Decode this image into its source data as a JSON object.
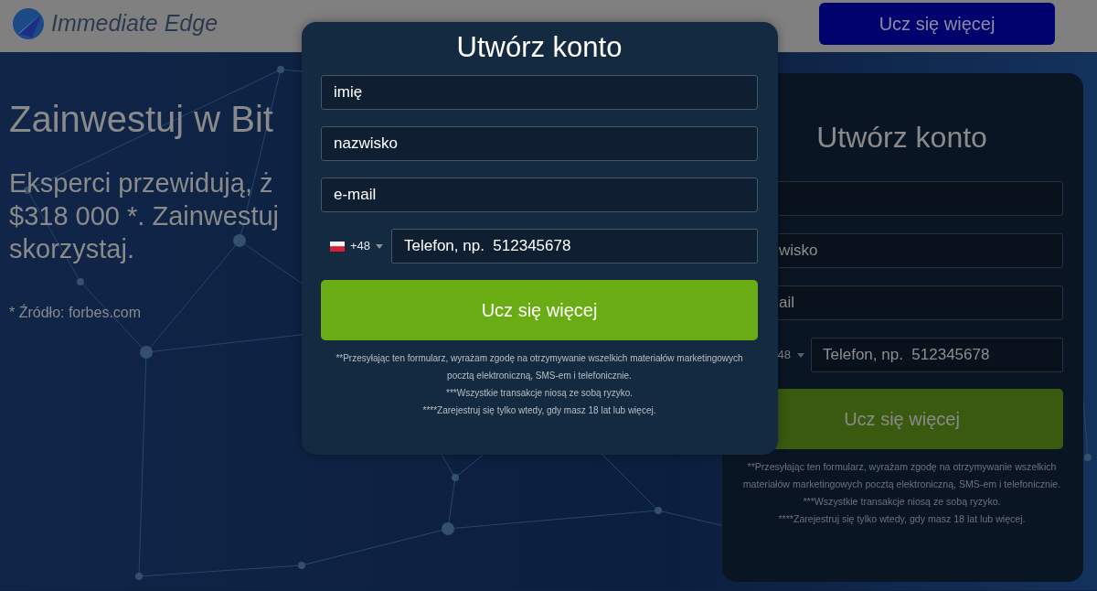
{
  "header": {
    "logo_text": "Immediate Edge",
    "cta_button": "Ucz się więcej"
  },
  "hero": {
    "title": "Zainwestuj w Bit",
    "subtitle_lines": [
      "Eksperci przewidują, ż",
      "$318 000 *. Zainwestuj",
      "skorzystaj."
    ],
    "source_note": "* Źródło: forbes.com"
  },
  "background_form": {
    "title": "Utwórz konto",
    "fields": [
      {
        "kind": "text"
      },
      {
        "kind": "text",
        "placeholder": "wisko"
      },
      {
        "kind": "text",
        "placeholder": "ail"
      },
      {
        "kind": "phone",
        "country_code": "48",
        "placeholder": "Telefon, np.  512345678"
      }
    ],
    "submit_button": "Ucz się więcej",
    "disclaimers": [
      "**Przesyłając ten formularz, wyrażam zgodę na otrzymywanie wszelkich materiałów marketingowych pocztą elektroniczną, SMS-em i telefonicznie.",
      "***Wszystkie transakcje niosą ze sobą ryzyko.",
      "****Zarejestruj się tylko wtedy, gdy masz 18 lat lub więcej."
    ]
  },
  "modal": {
    "title": "Utwórz konto",
    "fields": [
      {
        "kind": "text",
        "placeholder": "imię"
      },
      {
        "kind": "text",
        "placeholder": "nazwisko"
      },
      {
        "kind": "text",
        "placeholder": "e-mail"
      },
      {
        "kind": "phone",
        "country_code": "+48",
        "placeholder": "Telefon, np.  512345678"
      }
    ],
    "submit_button": "Ucz się więcej",
    "disclaimers": [
      "**Przesyłając ten formularz, wyrażam zgodę na otrzymywanie wszelkich materiałów marketingowych pocztą elektroniczną, SMS-em i telefonicznie.",
      "***Wszystkie transakcje niosą ze sobą ryzyko.",
      "****Zarejestruj się tylko wtedy, gdy masz 18 lat lub więcej."
    ]
  }
}
